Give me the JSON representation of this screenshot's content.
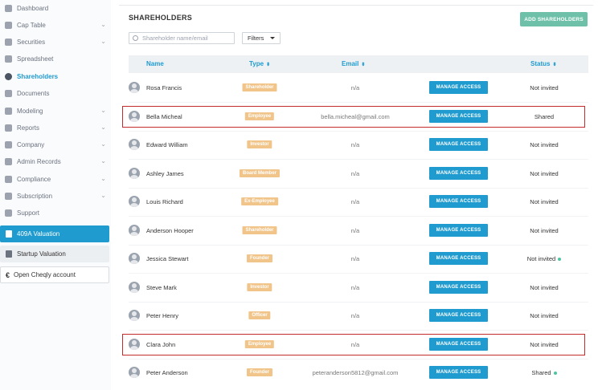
{
  "sidebar": {
    "items": [
      {
        "label": "Dashboard",
        "chevron": false,
        "active": false,
        "icon": "dashboard-icon"
      },
      {
        "label": "Cap Table",
        "chevron": true,
        "active": false,
        "icon": "cap-table-icon"
      },
      {
        "label": "Securities",
        "chevron": true,
        "active": false,
        "icon": "securities-icon"
      },
      {
        "label": "Spreadsheet",
        "chevron": false,
        "active": false,
        "icon": "spreadsheet-icon"
      },
      {
        "label": "Shareholders",
        "chevron": false,
        "active": true,
        "icon": "shareholders-icon"
      },
      {
        "label": "Documents",
        "chevron": false,
        "active": false,
        "icon": "documents-icon"
      },
      {
        "label": "Modeling",
        "chevron": true,
        "active": false,
        "icon": "modeling-icon"
      },
      {
        "label": "Reports",
        "chevron": true,
        "active": false,
        "icon": "reports-icon"
      },
      {
        "label": "Company",
        "chevron": true,
        "active": false,
        "icon": "company-icon"
      },
      {
        "label": "Admin Records",
        "chevron": true,
        "active": false,
        "icon": "admin-records-icon"
      },
      {
        "label": "Compliance",
        "chevron": true,
        "active": false,
        "icon": "compliance-icon"
      },
      {
        "label": "Subscription",
        "chevron": true,
        "active": false,
        "icon": "subscription-icon"
      },
      {
        "label": "Support",
        "chevron": false,
        "active": false,
        "icon": "support-icon"
      }
    ],
    "valuation_409a": "409A Valuation",
    "startup_valuation": "Startup Valuation",
    "open_cheqly": "Open Cheqly account",
    "chevron_glyph": "⌄"
  },
  "header": {
    "title": "SHAREHOLDERS",
    "add_button": "ADD SHAREHOLDERS"
  },
  "search": {
    "placeholder": "Shareholder name/email"
  },
  "filters": {
    "label": "Filters"
  },
  "table": {
    "columns": {
      "name": "Name",
      "type": "Type",
      "email": "Email",
      "status": "Status"
    },
    "sort_glyph": "⬍",
    "manage_label": "MANAGE ACCESS",
    "rows": [
      {
        "name": "Rosa Francis",
        "type": "Shareholder",
        "email": "n/a",
        "status": "Not invited",
        "dot": false,
        "highlight": false
      },
      {
        "name": "Bella Micheal",
        "type": "Employee",
        "email": "bella.micheal@gmail.com",
        "status": "Shared",
        "dot": false,
        "highlight": true
      },
      {
        "name": "Edward William",
        "type": "Investor",
        "email": "n/a",
        "status": "Not invited",
        "dot": false,
        "highlight": false
      },
      {
        "name": "Ashley James",
        "type": "Board Member",
        "email": "n/a",
        "status": "Not invited",
        "dot": false,
        "highlight": false
      },
      {
        "name": "Louis Richard",
        "type": "Ex-Employee",
        "email": "n/a",
        "status": "Not invited",
        "dot": false,
        "highlight": false
      },
      {
        "name": "Anderson Hooper",
        "type": "Shareholder",
        "email": "n/a",
        "status": "Not invited",
        "dot": false,
        "highlight": false
      },
      {
        "name": "Jessica Stewart",
        "type": "Founder",
        "email": "n/a",
        "status": "Not invited",
        "dot": true,
        "highlight": false
      },
      {
        "name": "Steve Mark",
        "type": "Investor",
        "email": "n/a",
        "status": "Not invited",
        "dot": false,
        "highlight": false
      },
      {
        "name": "Peter Henry",
        "type": "Officer",
        "email": "n/a",
        "status": "Not invited",
        "dot": false,
        "highlight": false
      },
      {
        "name": "Clara John",
        "type": "Employee",
        "email": "n/a",
        "status": "Not invited",
        "dot": false,
        "highlight": true
      },
      {
        "name": "Peter Anderson",
        "type": "Founder",
        "email": "peteranderson5812@gmail.com",
        "status": "Shared",
        "dot": true,
        "highlight": false
      }
    ]
  },
  "colors": {
    "accent": "#1f9bcf",
    "add_button": "#6ec1a8",
    "type_badge": "#f1c48a",
    "highlight": "#c42b2b",
    "status_dot": "#4fc3a1"
  }
}
